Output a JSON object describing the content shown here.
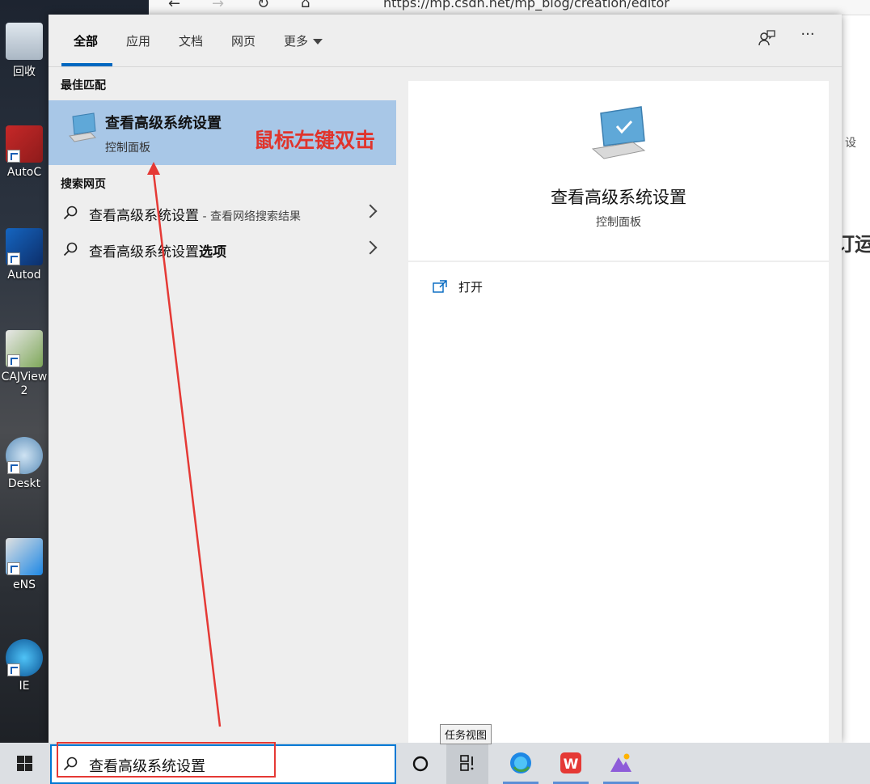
{
  "browser": {
    "url": "https://mp.csdn.net/mp_blog/creation/editor",
    "side_text_1": "设",
    "side_text_2": "订运"
  },
  "desktop": {
    "icons": [
      {
        "label": "回收"
      },
      {
        "label": "AutoC"
      },
      {
        "label": "Autod"
      },
      {
        "label": "CAJView\n2"
      },
      {
        "label": "Deskt"
      },
      {
        "label": "eNS"
      },
      {
        "label": "IE"
      }
    ]
  },
  "search_panel": {
    "tabs": [
      {
        "label": "全部",
        "active": true
      },
      {
        "label": "应用"
      },
      {
        "label": "文档"
      },
      {
        "label": "网页"
      },
      {
        "label": "更多"
      }
    ],
    "feedback_icon": "feedback-icon",
    "more_options_label": "···",
    "best_match_heading": "最佳匹配",
    "best_match": {
      "title": "查看高级系统设置",
      "subtitle": "控制面板"
    },
    "annotation": "鼠标左键双击",
    "web_heading": "搜索网页",
    "web_results": [
      {
        "main": "查看高级系统设置",
        "suffix": " - 查看网络搜索结果",
        "bold_suffix": ""
      },
      {
        "main": "查看高级系统设置",
        "suffix": "",
        "bold_suffix": "选项"
      }
    ],
    "detail": {
      "title": "查看高级系统设置",
      "subtitle": "控制面板",
      "open_label": "打开"
    }
  },
  "taskbar": {
    "search_value": "查看高级系统设置",
    "tooltip": "任务视图",
    "accent": "#0078d4"
  }
}
